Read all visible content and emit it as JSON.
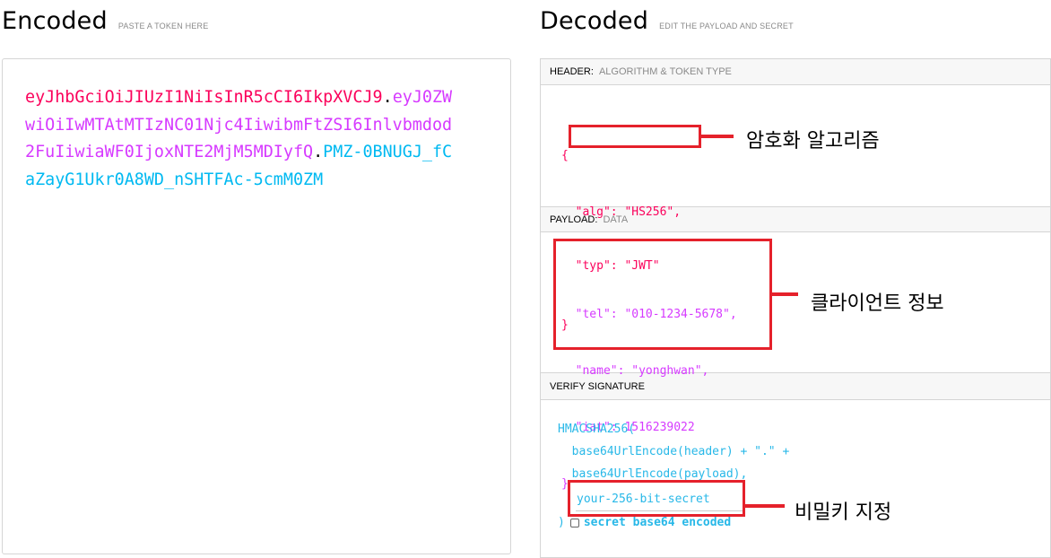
{
  "encoded": {
    "title": "Encoded",
    "hint": "PASTE A TOKEN HERE",
    "token_header": "eyJhbGciOiJIUzI1NiIsInR5cCI6IkpXVCJ9",
    "token_payload": "eyJ0ZWwiOiIwMTAtMTIzNC01Njc4IiwibmFtZSI6Inlvbmdod2FuIiwiaWF0IjoxNTE2MjM5MDIyfQ",
    "token_signature": "PMZ-0BNUGJ_fCaZayG1Ukr0A8WD_nSHTFAc-5cmM0ZM",
    "dot": "."
  },
  "decoded": {
    "title": "Decoded",
    "hint": "EDIT THE PAYLOAD AND SECRET",
    "header_section": {
      "label": "HEADER:",
      "sub": "ALGORITHM & TOKEN TYPE",
      "lines": [
        "{",
        "  \"alg\": \"HS256\",",
        "  \"typ\": \"JWT\"",
        "}"
      ]
    },
    "payload_section": {
      "label": "PAYLOAD:",
      "sub": "DATA",
      "lines": [
        "{",
        "  \"tel\": \"010-1234-5678\",",
        "  \"name\": \"yonghwan\",",
        "  \"iat\": 1516239022",
        "}"
      ]
    },
    "verify_section": {
      "label": "VERIFY SIGNATURE",
      "lines": [
        "HMACSHA256(",
        "  base64UrlEncode(header) + \".\" +",
        "  base64UrlEncode(payload),"
      ],
      "secret_value": "your-256-bit-secret",
      "close_paren": ")",
      "checkbox_label": "secret base64 encoded",
      "checkbox_checked": false
    }
  },
  "annotations": {
    "algorithm": "암호화 알고리즘",
    "client_info": "클라이언트 정보",
    "secret_key": "비밀키 지정"
  },
  "colors": {
    "header": "#fb015b",
    "payload": "#d63aff",
    "signature": "#00b9f1",
    "highlight": "#e5212b"
  }
}
